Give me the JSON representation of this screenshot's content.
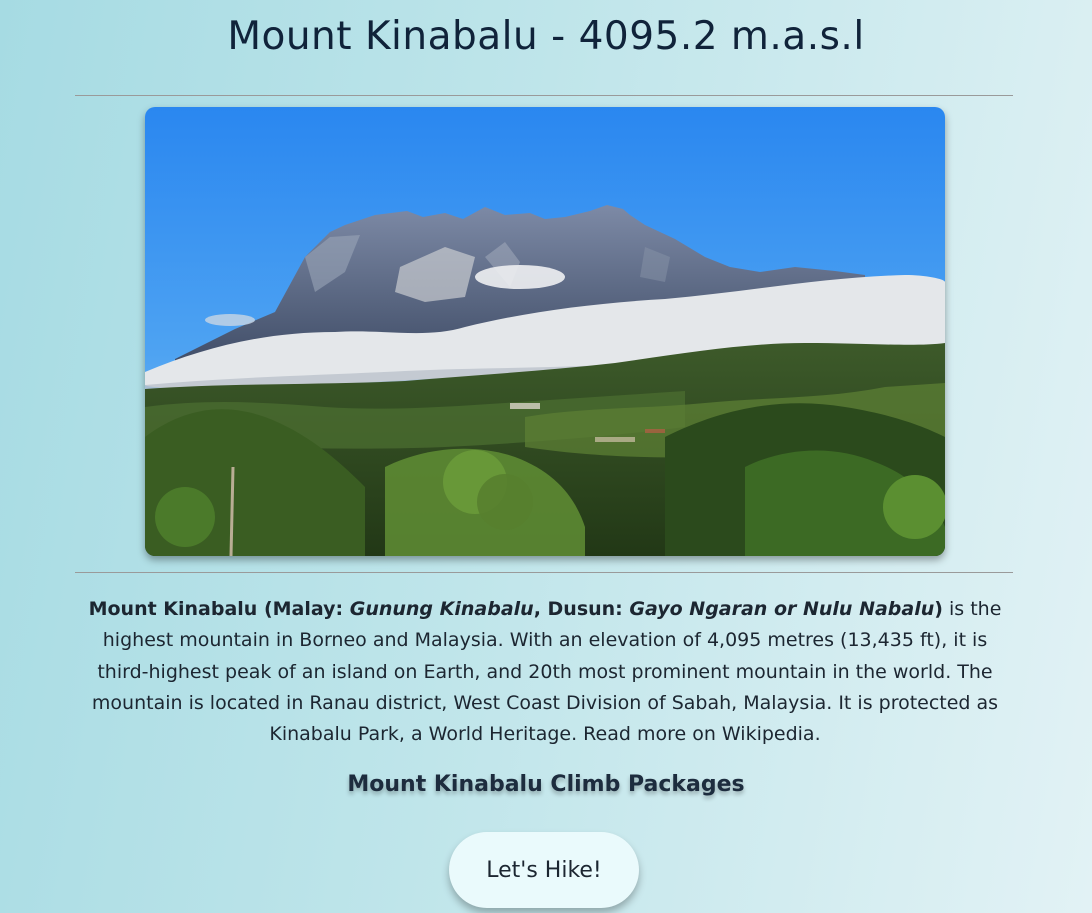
{
  "page": {
    "title": "Mount Kinabalu - 4095.2 m.a.s.l"
  },
  "photo": {
    "description_icon": "mountain-landscape-photo",
    "colors": {
      "sky": "#2f8ff0",
      "mountain": "#5f6c86",
      "cloud": "#e3e6ea",
      "forest": "#2f4a1e"
    }
  },
  "description": {
    "name": "Mount Kinabalu",
    "malay_prefix": " (Malay: ",
    "malay_name": "Gunung Kinabalu",
    "dusun_prefix": ", Dusun: ",
    "dusun_name": "Gayo Ngaran or Nulu Nabalu",
    "close_paren": ")",
    "body": " is the highest mountain in Borneo and Malaysia. With an elevation of 4,095 metres (13,435 ft), it is third-highest peak of an island on Earth, and 20th most prominent mountain in the world. The mountain is located in Ranau district, West Coast Division of Sabah, Malaysia. It is protected as Kinabalu Park, a World Heritage. ",
    "read_more": "Read more on Wikipedia."
  },
  "packages": {
    "heading": "Mount Kinabalu Climb Packages"
  },
  "cta": {
    "label": "Let's Hike!"
  }
}
